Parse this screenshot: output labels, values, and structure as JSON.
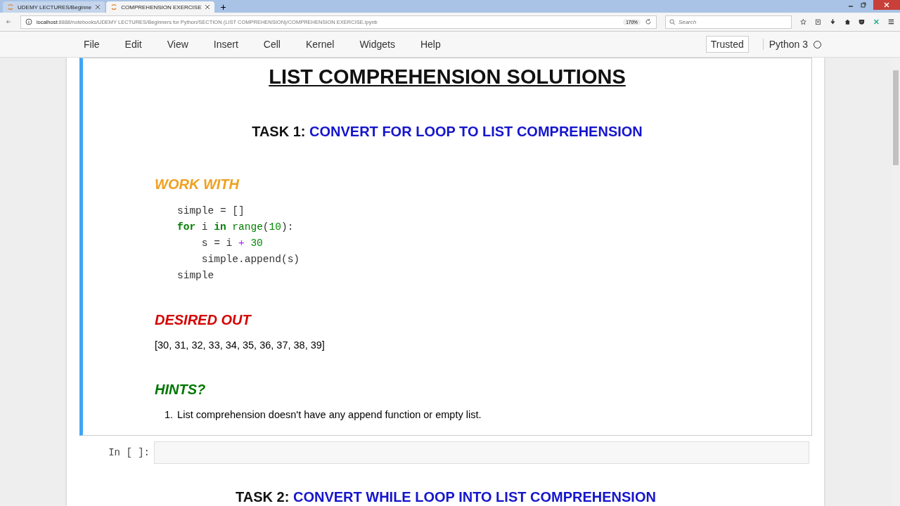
{
  "browser": {
    "tabs": [
      {
        "title": "UDEMY LECTURES/Beginne",
        "selected": false
      },
      {
        "title": "COMPREHENSION EXERCISE",
        "selected": true
      }
    ],
    "new_tab": "+",
    "url_host": "localhost",
    "url_rest": ":8888/notebooks/UDEMY LECTURES/Beginners for Python/SECTION  (LIST COMPREHENSION)/COMPREHENSION EXERCISE.ipynb",
    "zoom": "170%",
    "search": {
      "placeholder": "Search"
    }
  },
  "menu": {
    "items": [
      "File",
      "Edit",
      "View",
      "Insert",
      "Cell",
      "Kernel",
      "Widgets",
      "Help"
    ],
    "trusted": "Trusted",
    "kernel": "Python 3",
    "kernel_busy": false
  },
  "markdown_cell": {
    "selected": true,
    "title": "LIST COMPREHENSION SOLUTIONS",
    "task": {
      "prefix": "TASK 1:",
      "text": "CONVERT FOR LOOP TO LIST COMPREHENSION"
    },
    "work_with": "WORK WITH",
    "code": [
      [
        {
          "text": "simple = []",
          "kind": "plain"
        }
      ],
      [
        {
          "text": "for",
          "kind": "keyword"
        },
        {
          "text": " i ",
          "kind": "plain"
        },
        {
          "text": "in",
          "kind": "keyword"
        },
        {
          "text": " range",
          "kind": "builtin"
        },
        {
          "text": "(",
          "kind": "plain"
        },
        {
          "text": "10",
          "kind": "number"
        },
        {
          "text": "):",
          "kind": "plain"
        }
      ],
      [
        {
          "text": "    s = i ",
          "kind": "plain"
        },
        {
          "text": "+",
          "kind": "operator"
        },
        {
          "text": " 30",
          "kind": "number"
        }
      ],
      [
        {
          "text": "    simple.append(s)",
          "kind": "plain"
        }
      ],
      [
        {
          "text": "simple",
          "kind": "plain"
        }
      ]
    ],
    "desired": "DESIRED OUT",
    "output": "[30, 31, 32, 33, 34, 35, 36, 37, 38, 39]",
    "hints": "HINTS?",
    "hint_items": [
      {
        "number": "1.",
        "text": "List comprehension doesn't have any append function or empty list."
      }
    ]
  },
  "code_cell": {
    "prompt": "In [ ]:",
    "selected": false
  },
  "next_task": {
    "prefix": "TASK 2:",
    "text": "CONVERT WHILE LOOP INTO LIST COMPREHENSION"
  }
}
